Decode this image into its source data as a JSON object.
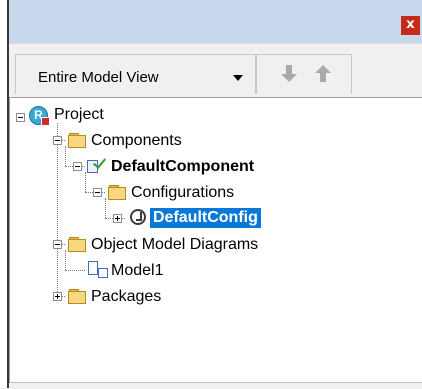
{
  "window": {
    "close_glyph": "x"
  },
  "toolbar": {
    "view_label": "Entire Model View",
    "dropdown_icon": "chevron-down-icon",
    "move_down_icon": "arrow-down-icon",
    "move_up_icon": "arrow-up-icon"
  },
  "tree": {
    "project": {
      "label": "Project",
      "icon_letter": "R"
    },
    "components": {
      "label": "Components"
    },
    "default_component": {
      "label": "DefaultComponent"
    },
    "configurations": {
      "label": "Configurations"
    },
    "default_config": {
      "label": "DefaultConfig"
    },
    "object_model_diagrams": {
      "label": "Object Model Diagrams"
    },
    "model1": {
      "label": "Model1"
    },
    "packages": {
      "label": "Packages"
    }
  },
  "colors": {
    "selection": "#0a78d7",
    "folder": "#f7d880",
    "close_button": "#c42b1c"
  }
}
